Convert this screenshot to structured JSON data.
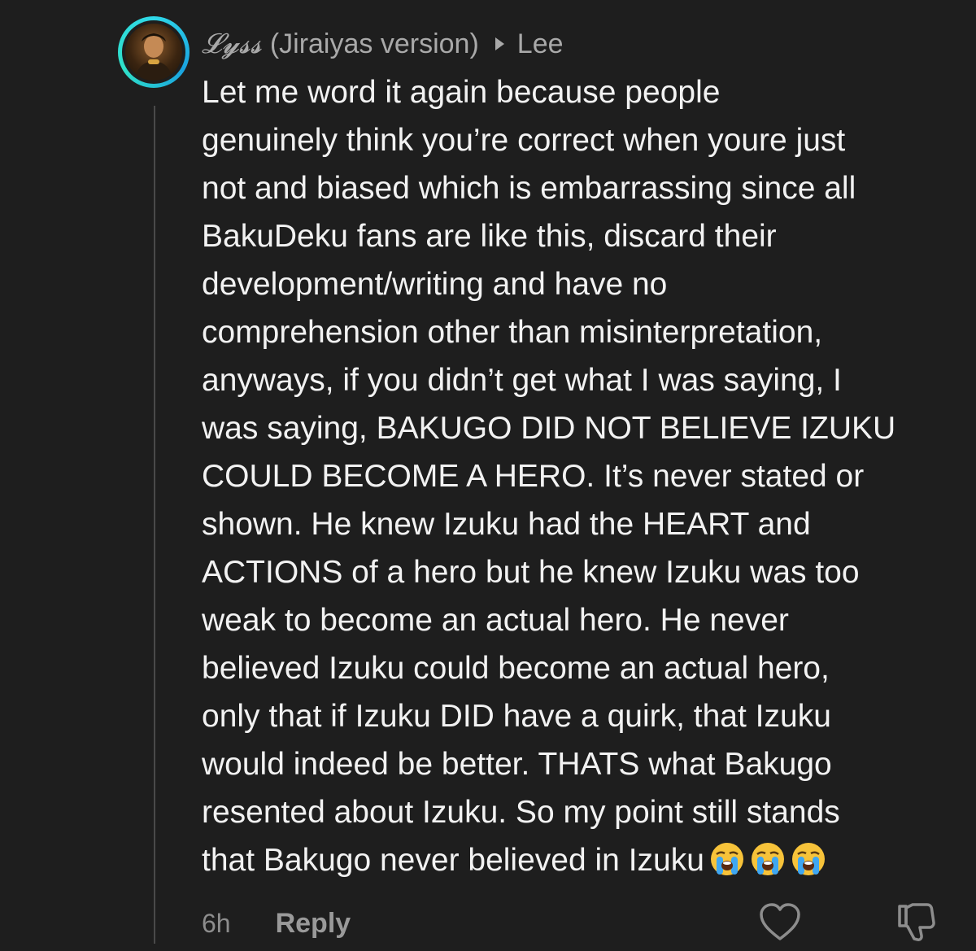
{
  "comment": {
    "username": "𝓛𝔂𝓼𝓼",
    "username_suffix": "(Jiraiyas version)",
    "reply_to": "Lee",
    "lines": [
      "Let me word it again because people",
      "genuinely think you’re correct when youre just",
      "not and biased which is embarrassing since all",
      "BakuDeku fans are like this, discard their",
      "development/writing and have no",
      "comprehension other than misinterpretation,",
      "anyways, if you didn’t get what I was saying, I",
      "was saying, BAKUGO DID NOT BELIEVE IZUKU",
      "COULD BECOME A HERO. It’s never stated or",
      "shown. He knew Izuku had the HEART and",
      "ACTIONS of a hero but he knew Izuku was too",
      "weak to become an actual hero. He never",
      "believed Izuku could become an actual hero,",
      "only that if Izuku DID have a quirk, that Izuku",
      "would indeed be better. THATS what Bakugo",
      "resented about Izuku. So my point still stands",
      "that Bakugo never believed in Izuku"
    ],
    "emojis": [
      "loudly-crying-face",
      "loudly-crying-face",
      "loudly-crying-face"
    ],
    "time": "6h",
    "reply_label": "Reply"
  },
  "icons": {
    "avatar": "avatar-photo",
    "reply_arrow": "play-arrow-icon",
    "like": "heart-outline-icon",
    "dislike": "thumbs-down-outline-icon"
  },
  "colors": {
    "background": "#1e1e1e",
    "text": "#f2f2f2",
    "muted": "#a9a9a9",
    "avatar_ring": "#2fd8e8"
  }
}
